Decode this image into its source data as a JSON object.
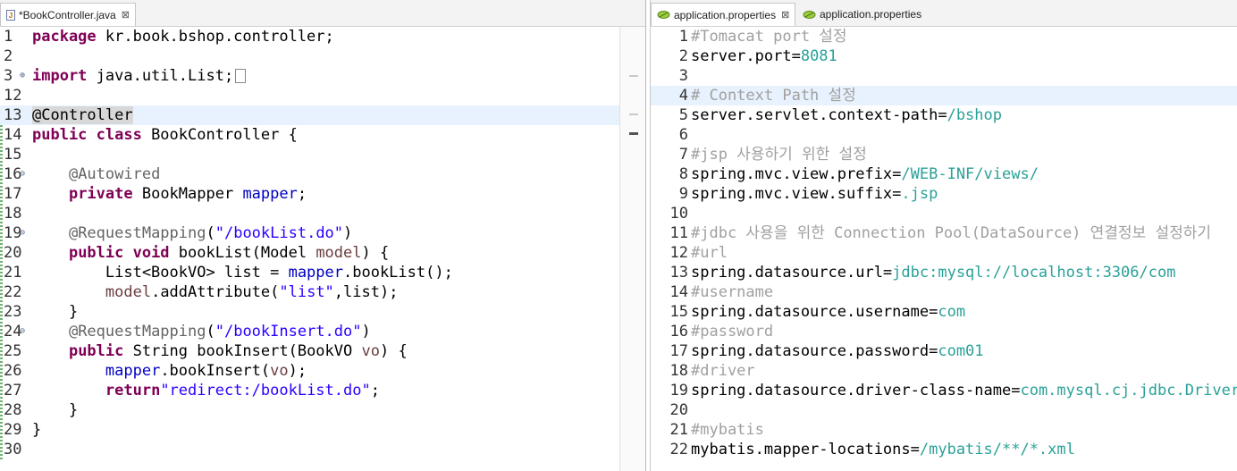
{
  "left_tab": {
    "label": "*BookController.java",
    "close": "⊠"
  },
  "right_tabs": [
    {
      "label": "application.properties",
      "close": "⊠"
    },
    {
      "label": "application.properties"
    }
  ],
  "left_lines": [
    {
      "n": "1",
      "segs": [
        [
          "kw",
          "package"
        ],
        [
          "plain",
          " kr.book.bshop.controller;"
        ]
      ]
    },
    {
      "n": "2",
      "segs": []
    },
    {
      "n": "3",
      "fold": "⊕",
      "segs": [
        [
          "kw",
          "import"
        ],
        [
          "plain",
          " java.util.List;"
        ]
      ],
      "ellipsis": true
    },
    {
      "n": "12",
      "segs": []
    },
    {
      "n": "13",
      "hl": true,
      "segs": [
        [
          "annbox",
          "@Controller"
        ]
      ]
    },
    {
      "n": "14",
      "segs": [
        [
          "kw",
          "public class"
        ],
        [
          "plain",
          " BookController {"
        ]
      ]
    },
    {
      "n": "15",
      "segs": []
    },
    {
      "n": "16",
      "fold": "⊖",
      "segs": [
        [
          "plain",
          "    "
        ],
        [
          "ann",
          "@Autowired"
        ]
      ]
    },
    {
      "n": "17",
      "segs": [
        [
          "plain",
          "    "
        ],
        [
          "kw",
          "private"
        ],
        [
          "plain",
          " BookMapper "
        ],
        [
          "field",
          "mapper"
        ],
        [
          "plain",
          ";"
        ]
      ]
    },
    {
      "n": "18",
      "segs": []
    },
    {
      "n": "19",
      "fold": "⊖",
      "segs": [
        [
          "plain",
          "    "
        ],
        [
          "ann",
          "@RequestMapping"
        ],
        [
          "plain",
          "("
        ],
        [
          "str",
          "\"/bookList.do\""
        ],
        [
          "plain",
          ")"
        ]
      ]
    },
    {
      "n": "20",
      "segs": [
        [
          "plain",
          "    "
        ],
        [
          "kw",
          "public void"
        ],
        [
          "plain",
          " bookList(Model "
        ],
        [
          "param",
          "model"
        ],
        [
          "plain",
          ") {"
        ]
      ]
    },
    {
      "n": "21",
      "segs": [
        [
          "plain",
          "        List<BookVO> list = "
        ],
        [
          "field",
          "mapper"
        ],
        [
          "plain",
          ".bookList();"
        ]
      ]
    },
    {
      "n": "22",
      "segs": [
        [
          "plain",
          "        "
        ],
        [
          "param",
          "model"
        ],
        [
          "plain",
          ".addAttribute("
        ],
        [
          "str",
          "\"list\""
        ],
        [
          "plain",
          ",list);"
        ]
      ]
    },
    {
      "n": "23",
      "segs": [
        [
          "plain",
          "    }"
        ]
      ]
    },
    {
      "n": "24",
      "fold": "⊖",
      "segs": [
        [
          "plain",
          "    "
        ],
        [
          "ann",
          "@RequestMapping"
        ],
        [
          "plain",
          "("
        ],
        [
          "str",
          "\"/bookInsert.do\""
        ],
        [
          "plain",
          ")"
        ]
      ]
    },
    {
      "n": "25",
      "segs": [
        [
          "plain",
          "    "
        ],
        [
          "kw",
          "public"
        ],
        [
          "plain",
          " String bookInsert(BookVO "
        ],
        [
          "param",
          "vo"
        ],
        [
          "plain",
          ") {"
        ]
      ]
    },
    {
      "n": "26",
      "segs": [
        [
          "plain",
          "        "
        ],
        [
          "field",
          "mapper"
        ],
        [
          "plain",
          ".bookInsert("
        ],
        [
          "param",
          "vo"
        ],
        [
          "plain",
          ");"
        ]
      ]
    },
    {
      "n": "27",
      "segs": [
        [
          "plain",
          "        "
        ],
        [
          "kw",
          "return"
        ],
        [
          "str",
          "\"redirect:/bookList.do\""
        ],
        [
          "plain",
          ";"
        ]
      ]
    },
    {
      "n": "28",
      "segs": [
        [
          "plain",
          "    }"
        ]
      ]
    },
    {
      "n": "29",
      "segs": [
        [
          "plain",
          "}"
        ]
      ]
    },
    {
      "n": "30",
      "segs": []
    }
  ],
  "right_lines": [
    {
      "n": "1",
      "segs": [
        [
          "cmt",
          "#Tomacat port 설정"
        ]
      ]
    },
    {
      "n": "2",
      "segs": [
        [
          "plain",
          "server.port="
        ],
        [
          "val",
          "8081"
        ]
      ]
    },
    {
      "n": "3",
      "segs": []
    },
    {
      "n": "4",
      "hl": true,
      "segs": [
        [
          "cmt",
          "# Context Path 설정"
        ]
      ]
    },
    {
      "n": "5",
      "segs": [
        [
          "plain",
          "server.servlet.context-path="
        ],
        [
          "val",
          "/bshop"
        ]
      ]
    },
    {
      "n": "6",
      "segs": []
    },
    {
      "n": "7",
      "segs": [
        [
          "cmt",
          "#jsp 사용하기 위한 설정"
        ]
      ]
    },
    {
      "n": "8",
      "segs": [
        [
          "plain",
          "spring.mvc.view.prefix="
        ],
        [
          "val",
          "/WEB-INF/views/"
        ]
      ]
    },
    {
      "n": "9",
      "segs": [
        [
          "plain",
          "spring.mvc.view.suffix="
        ],
        [
          "val",
          ".jsp"
        ]
      ]
    },
    {
      "n": "10",
      "segs": []
    },
    {
      "n": "11",
      "segs": [
        [
          "cmt",
          "#jdbc 사용을 위한 Connection Pool(DataSource) 연결정보 설정하기"
        ]
      ]
    },
    {
      "n": "12",
      "segs": [
        [
          "cmt",
          "#url"
        ]
      ]
    },
    {
      "n": "13",
      "segs": [
        [
          "plain",
          "spring.datasource.url="
        ],
        [
          "val",
          "jdbc:mysql://localhost:3306/com"
        ]
      ]
    },
    {
      "n": "14",
      "segs": [
        [
          "cmt",
          "#username"
        ]
      ]
    },
    {
      "n": "15",
      "segs": [
        [
          "plain",
          "spring.datasource.username="
        ],
        [
          "val",
          "com"
        ]
      ]
    },
    {
      "n": "16",
      "segs": [
        [
          "cmt",
          "#password"
        ]
      ]
    },
    {
      "n": "17",
      "segs": [
        [
          "plain",
          "spring.datasource.password="
        ],
        [
          "val",
          "com01"
        ]
      ]
    },
    {
      "n": "18",
      "segs": [
        [
          "cmt",
          "#driver"
        ]
      ]
    },
    {
      "n": "19",
      "segs": [
        [
          "plain",
          "spring.datasource.driver-class-name="
        ],
        [
          "val",
          "com.mysql.cj.jdbc.Driver"
        ]
      ]
    },
    {
      "n": "20",
      "segs": []
    },
    {
      "n": "21",
      "segs": [
        [
          "cmt",
          "#mybatis"
        ]
      ]
    },
    {
      "n": "22",
      "segs": [
        [
          "plain",
          "mybatis.mapper-locations="
        ],
        [
          "val",
          "/mybatis/**/*.xml"
        ]
      ]
    }
  ]
}
